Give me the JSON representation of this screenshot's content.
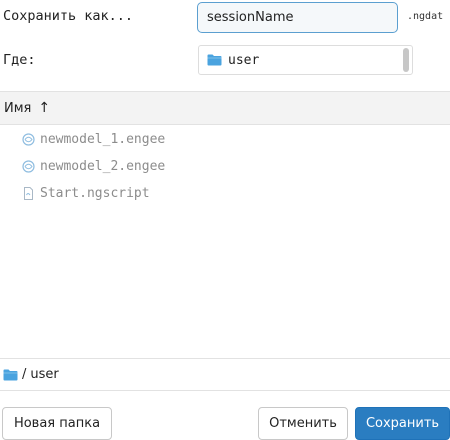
{
  "save_as": {
    "label": "Сохранить как...",
    "file_name_value": "sessionName",
    "extension": ".ngdat"
  },
  "where": {
    "label": "Где:",
    "value": "user"
  },
  "list": {
    "column_name": "Имя",
    "sort_indicator": "↑",
    "files": [
      {
        "name": "newmodel_1.engee",
        "icon": "engee-model-icon"
      },
      {
        "name": "newmodel_2.engee",
        "icon": "engee-model-icon"
      },
      {
        "name": "Start.ngscript",
        "icon": "script-file-icon"
      }
    ]
  },
  "path": {
    "separator": "/",
    "folder": "user"
  },
  "buttons": {
    "new_folder": "Новая папка",
    "cancel": "Отменить",
    "save": "Сохранить"
  },
  "colors": {
    "primary": "#2a7dc1",
    "folder": "#4aa3df",
    "input_border": "#5b9fd0",
    "muted_text": "#8c8c8c"
  }
}
